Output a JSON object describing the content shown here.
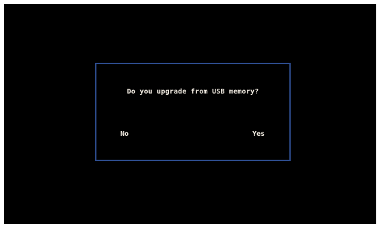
{
  "dialog": {
    "message": "Do you upgrade from USB memory?",
    "no_label": "No",
    "yes_label": "Yes",
    "border_color": "#2c4a8a"
  }
}
